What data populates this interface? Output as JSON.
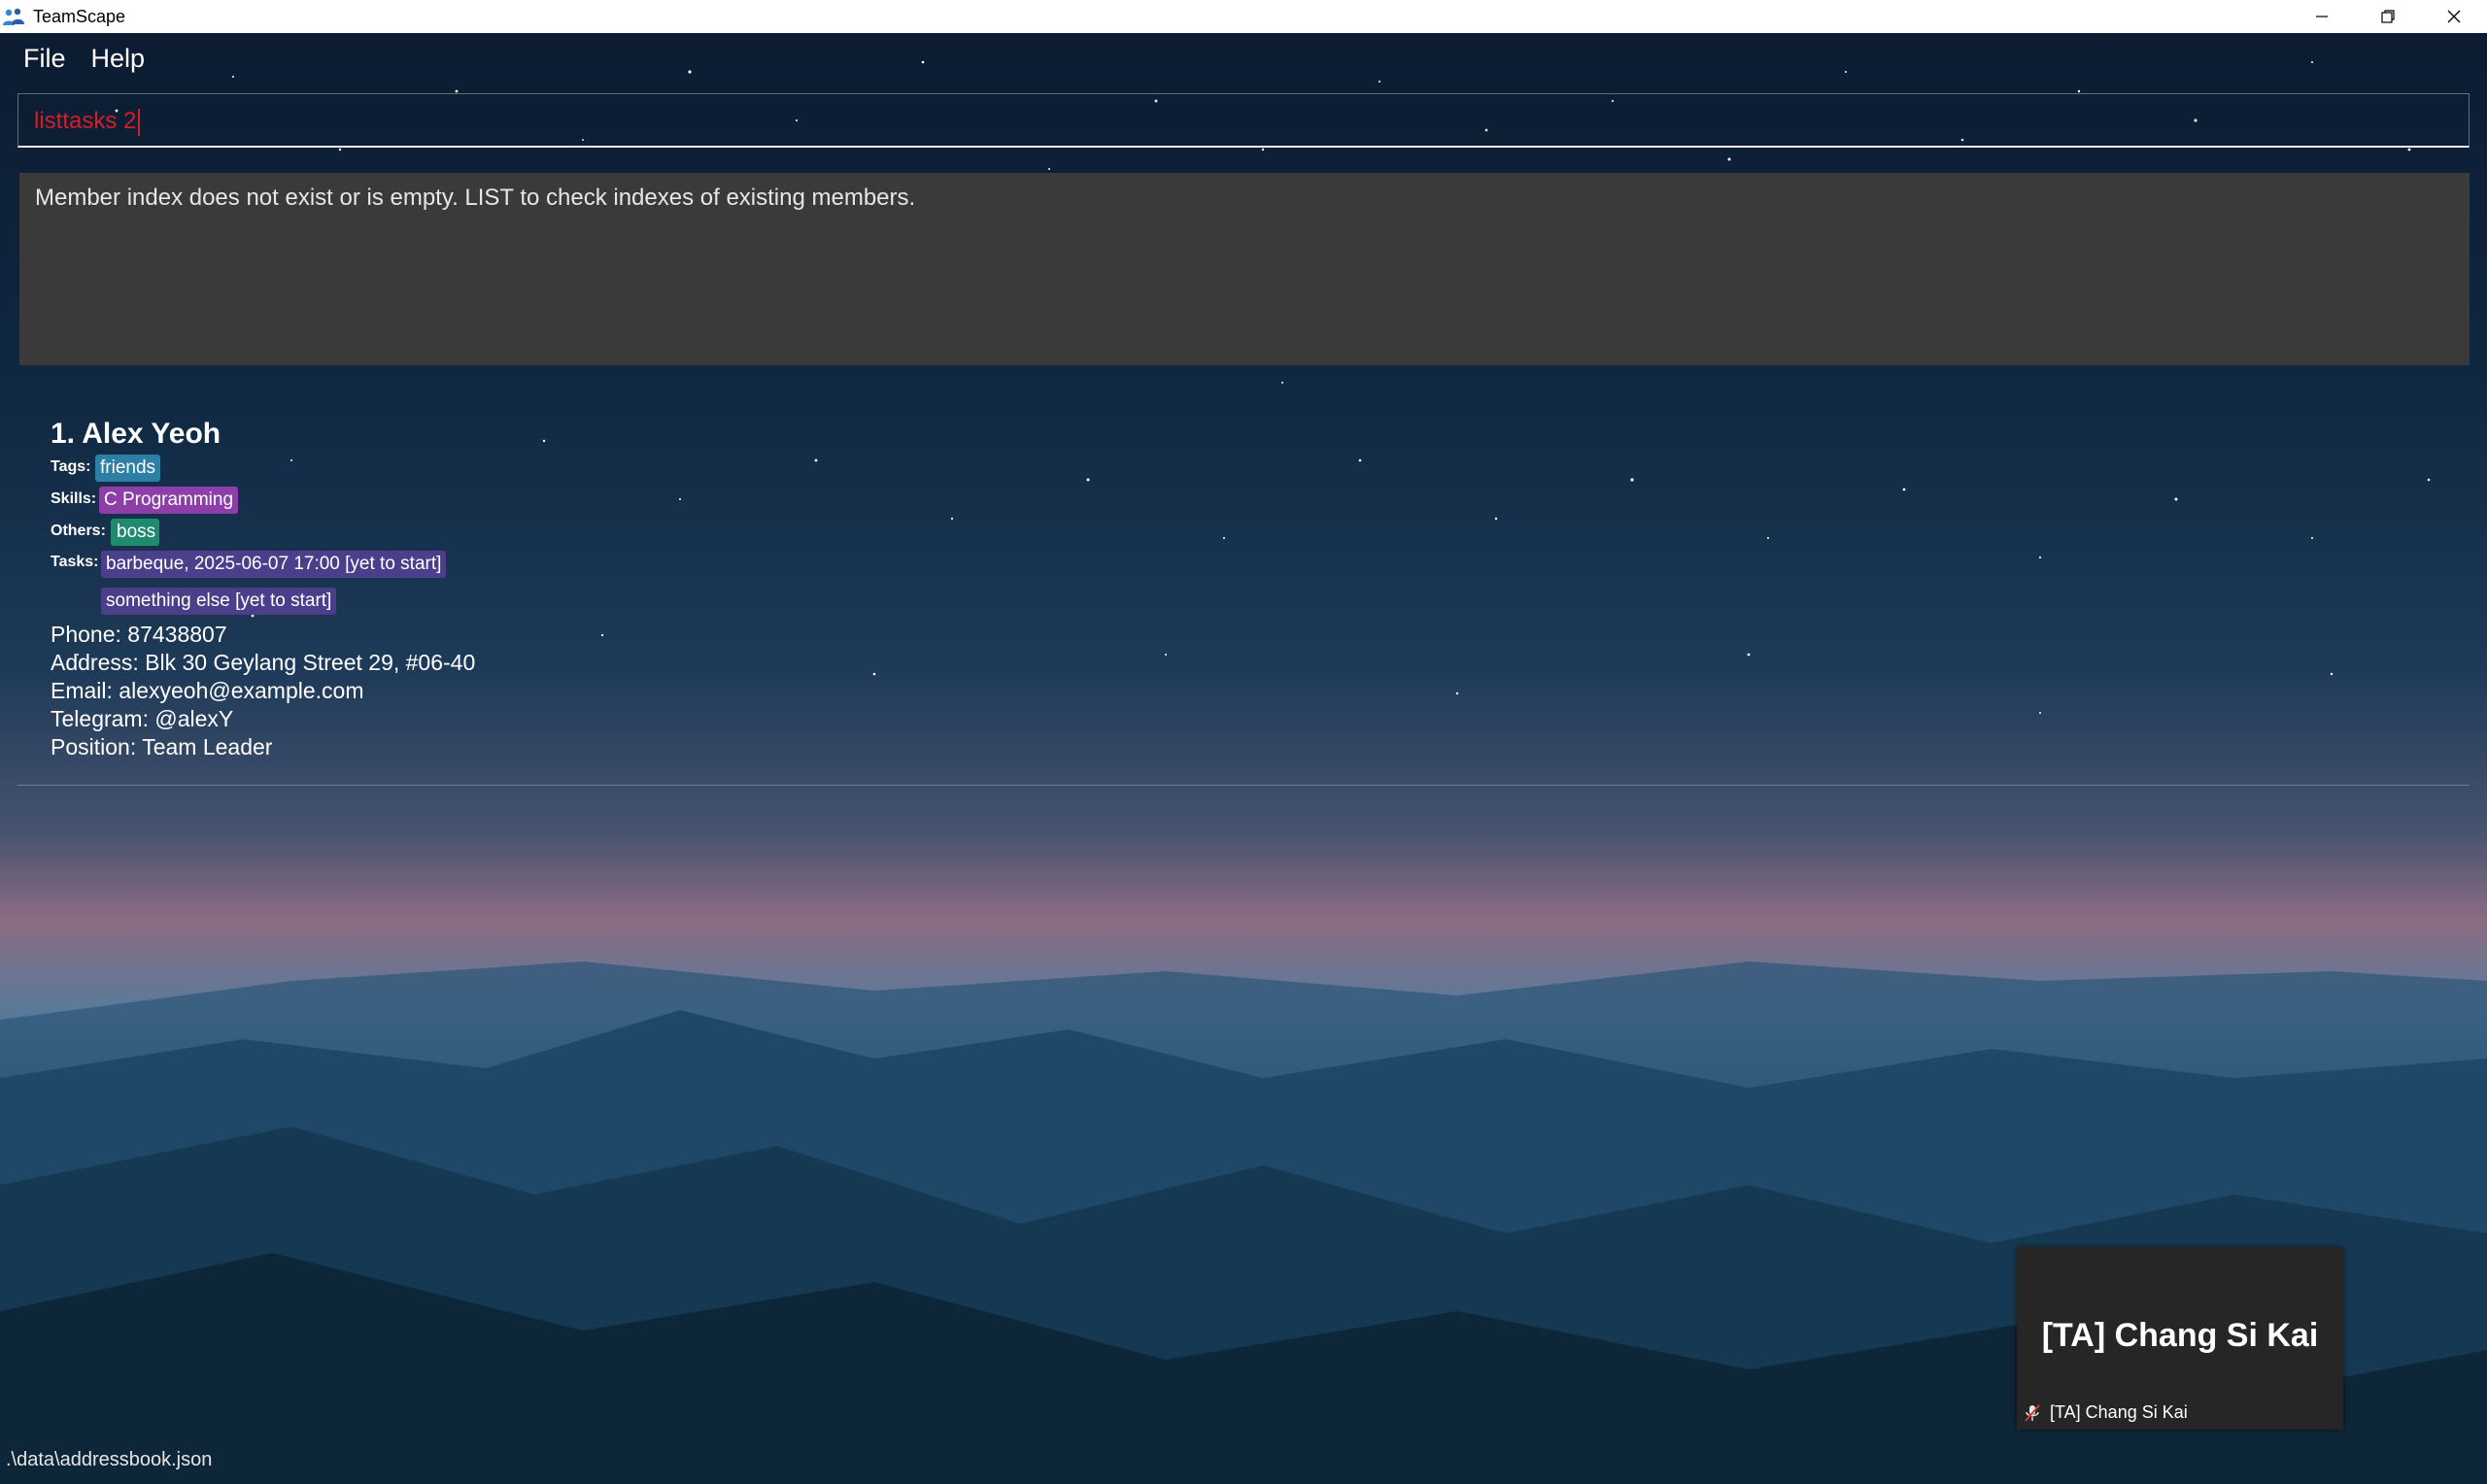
{
  "window": {
    "title": "TeamScape",
    "app_icon": "people-icon",
    "controls": [
      "minimize-icon",
      "restore-icon",
      "close-icon"
    ]
  },
  "menu": {
    "items": [
      {
        "label": "File"
      },
      {
        "label": "Help"
      }
    ]
  },
  "command": {
    "value": "listtasks 2",
    "text_color": "#d0202a"
  },
  "result": {
    "message": "Member index does not exist or is empty. LIST to check indexes of existing members."
  },
  "person": {
    "name": "1. Alex Yeoh",
    "tags_label": "Tags:",
    "tags": [
      "friends"
    ],
    "skills_label": "Skills:",
    "skills": [
      "C Programming"
    ],
    "others_label": "Others:",
    "others": [
      "boss"
    ],
    "tasks_label": "Tasks:",
    "tasks": [
      "barbeque, 2025-06-07 17:00 [yet to start]",
      "something else [yet to start]"
    ],
    "phone": "Phone: 87438807",
    "address": "Address: Blk 30 Geylang Street 29, #06-40",
    "email": "Email: alexyeoh@example.com",
    "telegram": "Telegram: @alexY",
    "position": "Position: Team Leader",
    "colors": {
      "tag": "#2e7fa6",
      "skill": "#8e3ea8",
      "other": "#1f8a6e",
      "task": "#4b3f8c"
    }
  },
  "status": {
    "path": ".\\data\\addressbook.json"
  },
  "call_tile": {
    "display_name": "[TA] Chang Si Kai",
    "footer_name": "[TA] Chang Si Kai",
    "mic_state": "mic-muted-icon"
  }
}
